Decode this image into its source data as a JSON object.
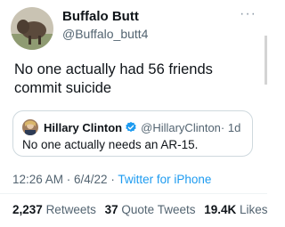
{
  "tweet": {
    "author": {
      "display_name": "Buffalo Butt",
      "handle": "@Buffalo_butt4"
    },
    "more_icon": "more-horizontal-icon",
    "text": "No one actually had 56 friends commit suicide",
    "quote": {
      "author": {
        "display_name": "Hillary Clinton",
        "handle": "@HillaryClinton",
        "time": "· 1d"
      },
      "verified_icon": "verified-badge-icon",
      "text": "No one actually needs an AR-15."
    },
    "timestamp": "12:26 AM · 6/4/22 · ",
    "source": "Twitter for iPhone",
    "stats": {
      "retweets_count": "2,237",
      "retweets_label": "Retweets",
      "quotes_count": "37",
      "quotes_label": "Quote Tweets",
      "likes_count": "19.4K",
      "likes_label": "Likes"
    }
  },
  "colors": {
    "text": "#0f1419",
    "secondary": "#536471",
    "link": "#1d9bf0",
    "border": "#cfd9de",
    "verified": "#1d9bf0"
  }
}
